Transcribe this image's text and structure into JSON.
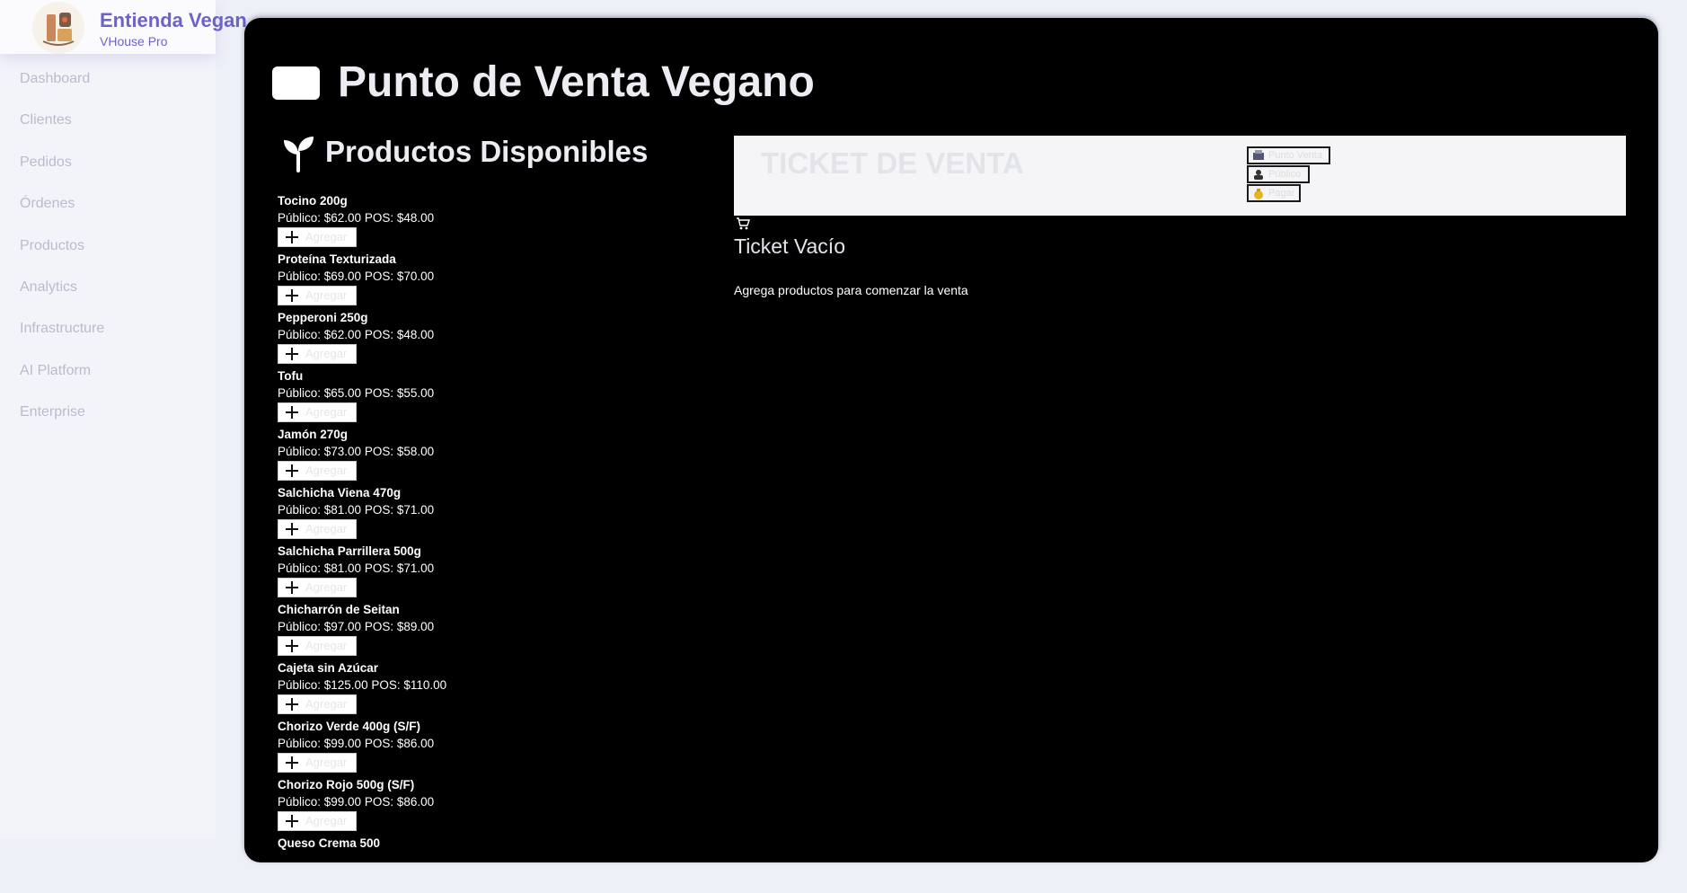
{
  "brand": {
    "name": "Entienda Vegan",
    "subtitle": "VHouse Pro"
  },
  "nav": [
    "Dashboard",
    "Clientes",
    "Pedidos",
    "Órdenes",
    "Productos",
    "Analytics",
    "Infrastructure",
    "AI Platform",
    "Enterprise"
  ],
  "page": {
    "title": "Punto de Venta Vegano"
  },
  "products_section": {
    "title": "Productos Disponibles",
    "add_label": "Agregar"
  },
  "products": [
    {
      "name": "Tocino 200g",
      "price": "Público: $62.00 POS: $48.00"
    },
    {
      "name": "Proteína Texturizada",
      "price": "Público: $69.00 POS: $70.00"
    },
    {
      "name": "Pepperoni 250g",
      "price": "Público: $62.00 POS: $48.00"
    },
    {
      "name": "Tofu",
      "price": "Público: $65.00 POS: $55.00"
    },
    {
      "name": "Jamón 270g",
      "price": "Público: $73.00 POS: $58.00"
    },
    {
      "name": "Salchicha Viena 470g",
      "price": "Público: $81.00 POS: $71.00"
    },
    {
      "name": "Salchicha Parrillera 500g",
      "price": "Público: $81.00 POS: $71.00"
    },
    {
      "name": "Chicharrón de Seitan",
      "price": "Público: $97.00 POS: $89.00"
    },
    {
      "name": "Cajeta sin Azúcar",
      "price": "Público: $125.00 POS: $110.00"
    },
    {
      "name": "Chorizo Verde 400g (S/F)",
      "price": "Público: $99.00 POS: $86.00"
    },
    {
      "name": "Chorizo Rojo 500g (S/F)",
      "price": "Público: $99.00 POS: $86.00"
    },
    {
      "name": "Queso Crema 500",
      "price": ""
    }
  ],
  "ticket": {
    "title": "TICKET DE VENTA",
    "options": [
      "Punto Venta",
      "Público",
      "Pagar"
    ],
    "empty_title": "Ticket Vacío",
    "empty_subtitle": "Agrega productos para comenzar la venta"
  }
}
